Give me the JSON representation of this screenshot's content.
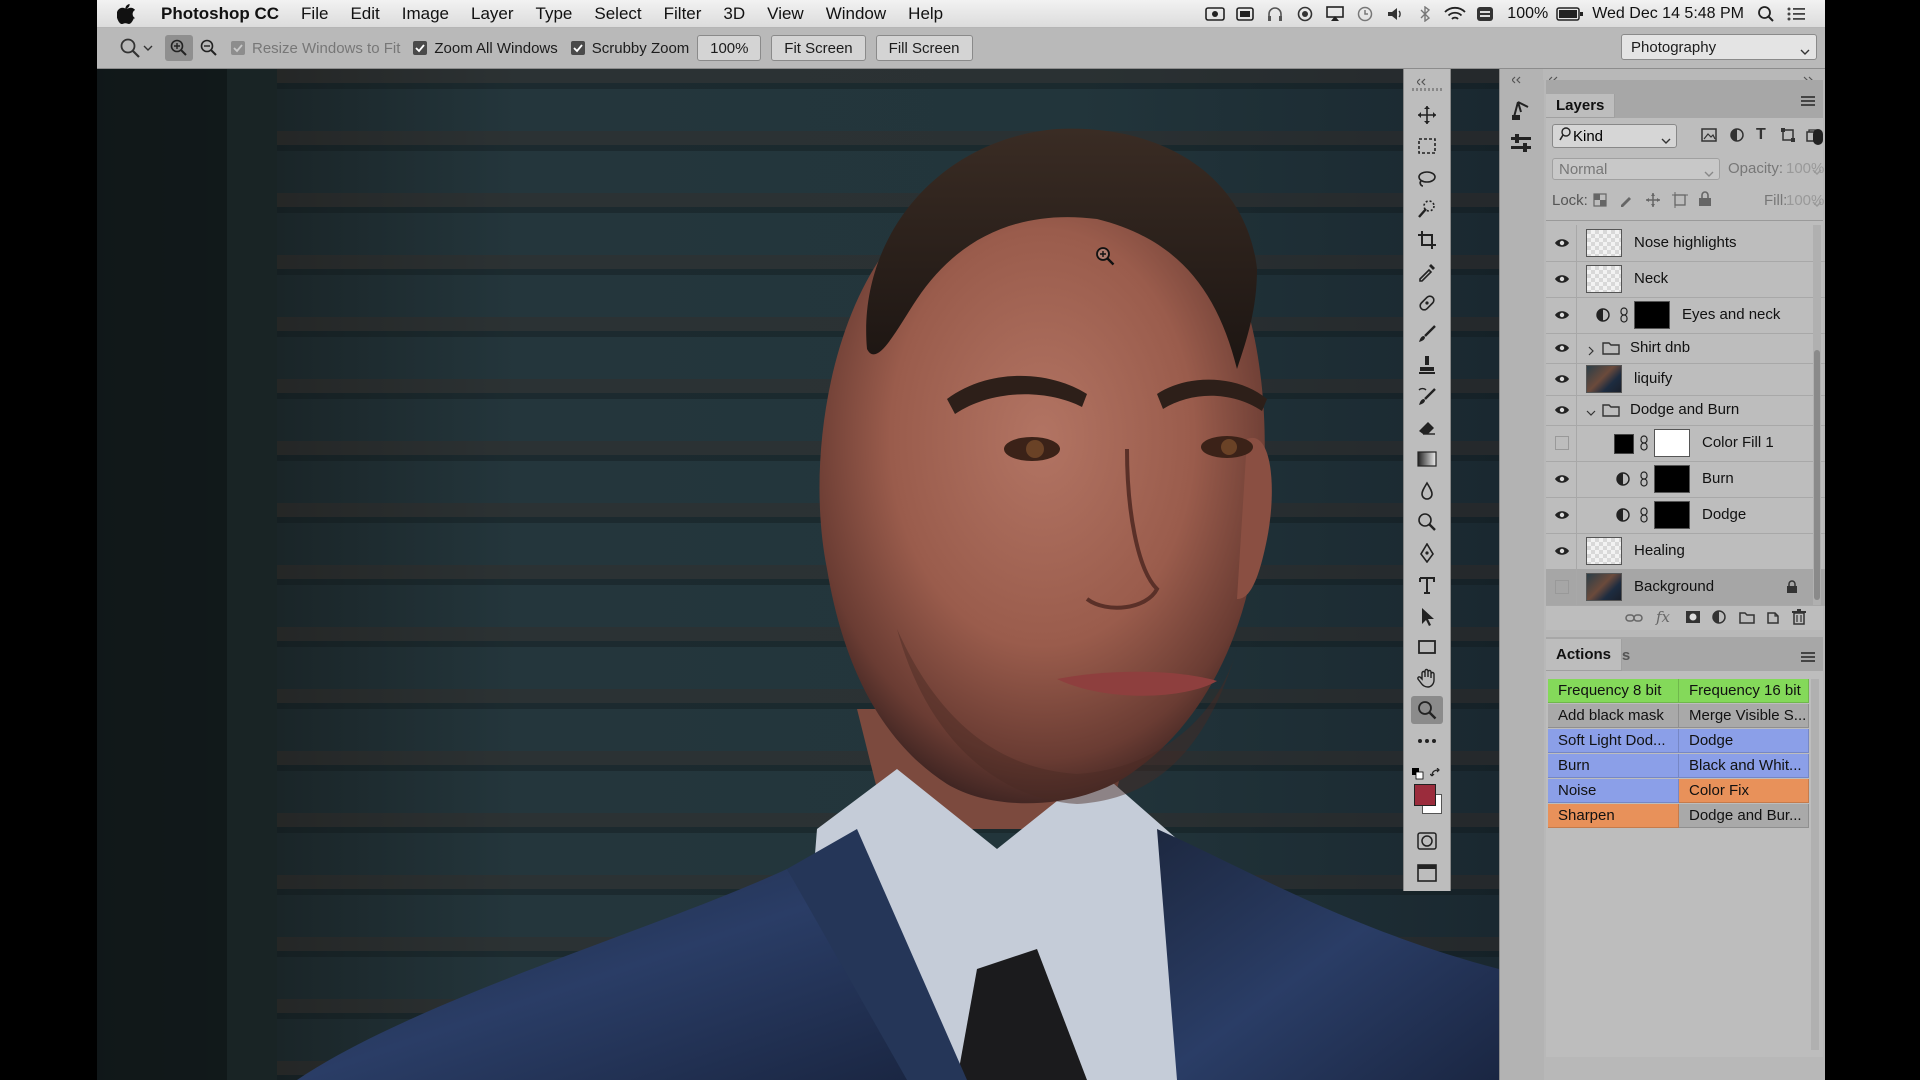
{
  "colors": {
    "green": "#84d95a",
    "gray": "#a9a9a9",
    "blue": "#8b9fe8",
    "orange": "#e8915a",
    "accent_fg": "#9b2c3c"
  },
  "menubar": {
    "app": "Photoshop CC",
    "items": [
      "File",
      "Edit",
      "Image",
      "Layer",
      "Type",
      "Select",
      "Filter",
      "3D",
      "View",
      "Window",
      "Help"
    ],
    "battery": "100%",
    "datetime": "Wed Dec 14  5:48 PM"
  },
  "options": {
    "resize_windows": "Resize Windows to Fit",
    "zoom_all": "Zoom All Windows",
    "scrubby": "Scrubby Zoom",
    "zoom_value": "100%",
    "fit_screen": "Fit Screen",
    "fill_screen": "Fill Screen",
    "workspace": "Photography"
  },
  "layers_panel": {
    "tab": "Layers",
    "filter_kind": "Kind",
    "blend_mode": "Normal",
    "opacity_label": "Opacity:",
    "opacity_value": "100%",
    "lock_label": "Lock:",
    "fill_label": "Fill:",
    "fill_value": "100%",
    "layers": [
      {
        "name": "Nose highlights",
        "visible": true
      },
      {
        "name": "Neck",
        "visible": true
      },
      {
        "name": "Eyes and neck",
        "visible": true
      },
      {
        "name": "Shirt dnb",
        "visible": true
      },
      {
        "name": "liquify",
        "visible": true
      },
      {
        "name": "Dodge and Burn",
        "visible": true
      },
      {
        "name": "Color Fill 1",
        "visible": false
      },
      {
        "name": "Burn",
        "visible": true
      },
      {
        "name": "Dodge",
        "visible": true
      },
      {
        "name": "Healing",
        "visible": true
      },
      {
        "name": "Background",
        "visible": false
      }
    ]
  },
  "actions_panel": {
    "tabs": [
      "Actions",
      "Properties"
    ],
    "buttons": [
      {
        "label": "Frequency 8 bit",
        "color": "green"
      },
      {
        "label": "Frequency 16 bit",
        "color": "green"
      },
      {
        "label": "Add black mask",
        "color": "gray"
      },
      {
        "label": "Merge Visible S...",
        "color": "gray"
      },
      {
        "label": "Soft Light Dod...",
        "color": "blue"
      },
      {
        "label": "Dodge",
        "color": "blue"
      },
      {
        "label": "Burn",
        "color": "blue"
      },
      {
        "label": "Black and Whit...",
        "color": "blue"
      },
      {
        "label": "Noise",
        "color": "blue"
      },
      {
        "label": "Color Fix",
        "color": "orange"
      },
      {
        "label": "Sharpen",
        "color": "orange"
      },
      {
        "label": "Dodge and Bur...",
        "color": "gray"
      }
    ]
  },
  "icons": {
    "tools": [
      "move-icon",
      "marquee-icon",
      "lasso-icon",
      "quick-select-icon",
      "crop-icon",
      "eyedropper-icon",
      "healing-icon",
      "brush-icon",
      "stamp-icon",
      "history-brush-icon",
      "eraser-icon",
      "gradient-icon",
      "blur-icon",
      "dodge-tool-icon",
      "pen-icon",
      "type-icon",
      "path-select-icon",
      "rectangle-icon",
      "hand-icon",
      "zoom-icon",
      "more-icon"
    ]
  }
}
